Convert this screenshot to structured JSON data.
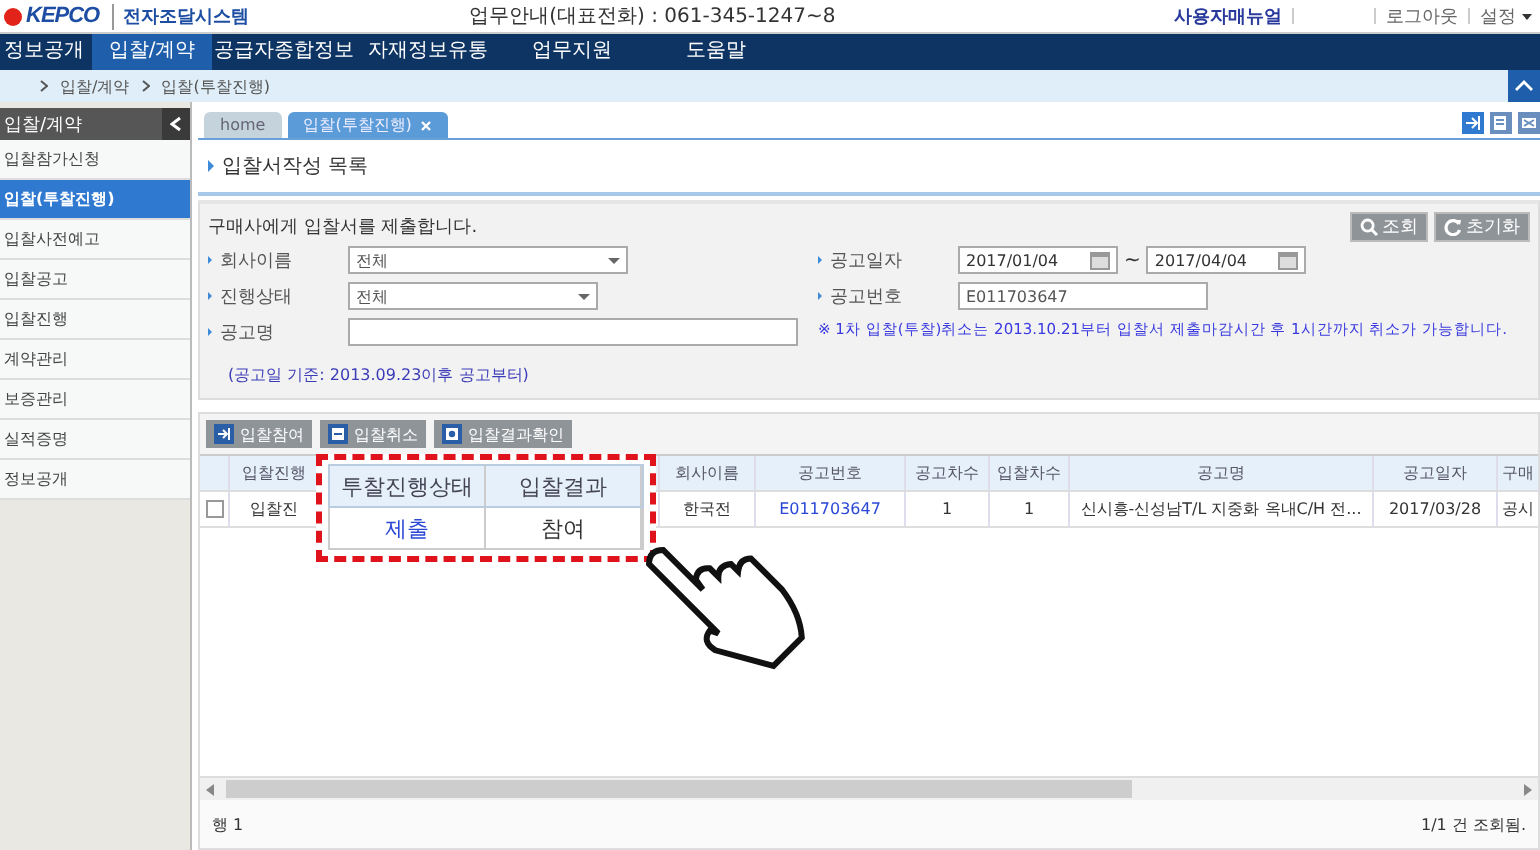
{
  "header": {
    "logo": "KEPCO",
    "system_name": "전자조달시스템",
    "contact": "업무안내(대표전화) : 061-345-1247~8",
    "links": [
      {
        "label": "사용자매뉴얼",
        "kind": "manual"
      },
      {
        "label": "로그아웃",
        "kind": "plain"
      },
      {
        "label": "설정",
        "kind": "menu"
      }
    ]
  },
  "nav": [
    {
      "label": "정보공개",
      "selected": false
    },
    {
      "label": "입찰/계약",
      "selected": true
    },
    {
      "label": "공급자종합정보",
      "selected": false
    },
    {
      "label": "자재정보유통",
      "selected": false
    },
    {
      "label": "업무지원",
      "selected": false
    },
    {
      "label": "도움말",
      "selected": false
    }
  ],
  "breadcrumb": [
    "입찰/계약",
    "입찰(투찰진행)"
  ],
  "sidebar": {
    "title": "입찰/계약",
    "items": [
      {
        "label": "입찰참가신청",
        "selected": false
      },
      {
        "label": "입찰(투찰진행)",
        "selected": true
      },
      {
        "label": "입찰사전예고",
        "selected": false
      },
      {
        "label": "입찰공고",
        "selected": false
      },
      {
        "label": "입찰진행",
        "selected": false
      },
      {
        "label": "계약관리",
        "selected": false
      },
      {
        "label": "보증관리",
        "selected": false
      },
      {
        "label": "실적증명",
        "selected": false
      },
      {
        "label": "정보공개",
        "selected": false
      }
    ]
  },
  "tabs": [
    {
      "label": "home",
      "selected": false,
      "closable": false
    },
    {
      "label": "입찰(투찰진행)",
      "selected": true,
      "closable": true
    }
  ],
  "page_title": "입찰서작성 목록",
  "search": {
    "description": "구매사에게 입찰서를 제출합니다.",
    "buttons": [
      {
        "label": "조회",
        "kind": "search"
      },
      {
        "label": "초기화",
        "kind": "reset"
      }
    ],
    "left_fields": [
      {
        "label": "회사이름",
        "kind": "select",
        "value": "전체"
      },
      {
        "label": "진행상태",
        "kind": "select",
        "value": "전체"
      },
      {
        "label": "공고명",
        "kind": "text"
      }
    ],
    "right_fields": [
      {
        "label": "공고일자",
        "kind": "daterange",
        "from": "2017/01/04",
        "separator": "~",
        "to": "2017/04/04"
      },
      {
        "label": "공고번호",
        "kind": "text",
        "value": "E011703647"
      }
    ],
    "left_note": "(공고일 기준: 2013.09.23이후 공고부터)",
    "right_note": "※ 1차 입찰(투찰)취소는 2013.10.21부터 입찰서 제출마감시간 후 1시간까지 취소가 가능합니다."
  },
  "actions": [
    {
      "label": "입찰참여",
      "kind": "enter"
    },
    {
      "label": "입찰취소",
      "kind": "cancel"
    },
    {
      "label": "입찰결과확인",
      "kind": "result"
    }
  ],
  "table": {
    "columns": [
      "입찰진행",
      "회사이름",
      "공고번호",
      "공고차수",
      "입찰차수",
      "공고명",
      "공고일자",
      "구매"
    ],
    "rows": [
      {
        "checked": false,
        "cells": [
          {
            "text": "입찰진",
            "kind": "text"
          },
          {
            "text": "한국전",
            "kind": "text"
          },
          {
            "text": "E011703647",
            "kind": "link"
          },
          {
            "text": "1",
            "kind": "text"
          },
          {
            "text": "1",
            "kind": "text"
          },
          {
            "text": "신시흥-신성남T/L 지중화 옥내C/H 전...",
            "kind": "text"
          },
          {
            "text": "2017/03/28",
            "kind": "text"
          },
          {
            "text": "공시",
            "kind": "text"
          }
        ]
      }
    ]
  },
  "callout": {
    "columns": [
      "투찰진행상태",
      "입찰결과"
    ],
    "cells": [
      {
        "text": "제출",
        "kind": "link"
      },
      {
        "text": "참여",
        "kind": "text"
      }
    ]
  },
  "footer": {
    "row_count": "행 1",
    "status": "1/1 건 조회됨."
  }
}
